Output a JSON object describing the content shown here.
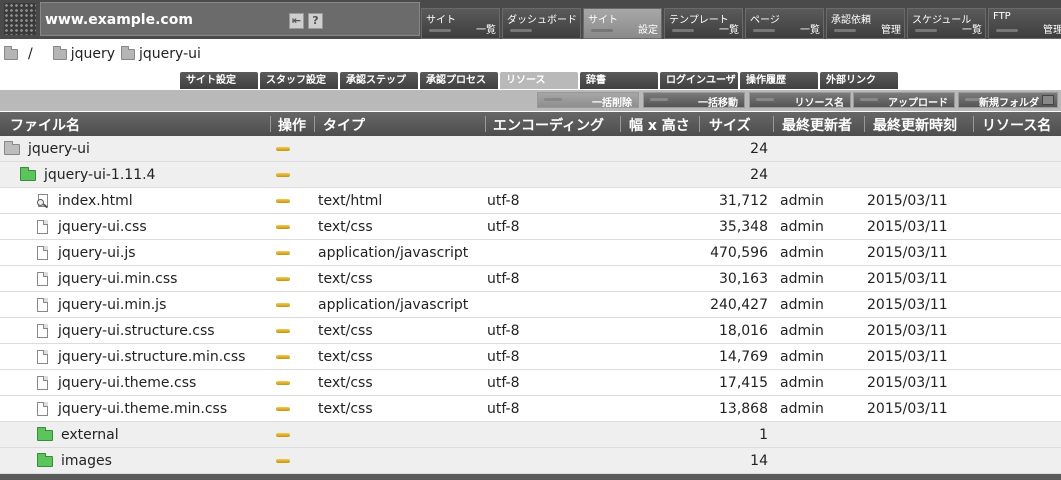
{
  "header": {
    "site_name": "www.example.com",
    "icons": [
      "logout-icon",
      "help-icon"
    ],
    "help_glyph": "?",
    "logout_glyph": "⇤",
    "nav": [
      {
        "line1": "サイト",
        "line2": "一覧",
        "active": false
      },
      {
        "line1": "ダッシュボード",
        "line2": "",
        "active": false
      },
      {
        "line1": "サイト",
        "line2": "設定",
        "active": true
      },
      {
        "line1": "テンプレート",
        "line2": "一覧",
        "active": false
      },
      {
        "line1": "ページ",
        "line2": "一覧",
        "active": false
      },
      {
        "line1": "承認依頼",
        "line2": "管理",
        "active": false
      },
      {
        "line1": "スケジュール",
        "line2": "一覧",
        "active": false
      },
      {
        "line1": "FTP",
        "line2": "管理",
        "active": false
      }
    ]
  },
  "breadcrumb": {
    "root": "/",
    "items": [
      "jquery",
      "jquery-ui"
    ]
  },
  "tabs": [
    {
      "label": "サイト設定",
      "active": false
    },
    {
      "label": "スタッフ設定",
      "active": false
    },
    {
      "label": "承認ステップ",
      "active": false
    },
    {
      "label": "承認プロセス",
      "active": false
    },
    {
      "label": "リソース",
      "active": true
    },
    {
      "label": "辞書",
      "active": false
    },
    {
      "label": "ログインユーザ",
      "active": false
    },
    {
      "label": "操作履歴",
      "active": false
    },
    {
      "label": "外部リンク",
      "active": false
    }
  ],
  "actions": {
    "bulk_delete": "一括削除",
    "bulk_move": "一括移動",
    "resource_name": "リソース名",
    "upload": "アップロード",
    "new_folder": "新規フォルダ"
  },
  "table": {
    "columns": [
      "ファイル名",
      "操作",
      "タイプ",
      "エンコーディング",
      "幅 x 高さ",
      "サイズ",
      "最終更新者",
      "最終更新時刻",
      "リソース名"
    ],
    "rows": [
      {
        "kind": "folder-grey",
        "indent": 0,
        "name": "jquery-ui",
        "type": "",
        "encoding": "",
        "size": "24",
        "user": "",
        "time": ""
      },
      {
        "kind": "folder-green",
        "indent": 1,
        "name": "jquery-ui-1.11.4",
        "type": "",
        "encoding": "",
        "size": "24",
        "user": "",
        "time": ""
      },
      {
        "kind": "html",
        "indent": 2,
        "name": "index.html",
        "type": "text/html",
        "encoding": "utf-8",
        "size": "31,712",
        "user": "admin",
        "time": "2015/03/11"
      },
      {
        "kind": "file",
        "indent": 2,
        "name": "jquery-ui.css",
        "type": "text/css",
        "encoding": "utf-8",
        "size": "35,348",
        "user": "admin",
        "time": "2015/03/11"
      },
      {
        "kind": "file",
        "indent": 2,
        "name": "jquery-ui.js",
        "type": "application/javascript",
        "encoding": "",
        "size": "470,596",
        "user": "admin",
        "time": "2015/03/11"
      },
      {
        "kind": "file",
        "indent": 2,
        "name": "jquery-ui.min.css",
        "type": "text/css",
        "encoding": "utf-8",
        "size": "30,163",
        "user": "admin",
        "time": "2015/03/11"
      },
      {
        "kind": "file",
        "indent": 2,
        "name": "jquery-ui.min.js",
        "type": "application/javascript",
        "encoding": "",
        "size": "240,427",
        "user": "admin",
        "time": "2015/03/11"
      },
      {
        "kind": "file",
        "indent": 2,
        "name": "jquery-ui.structure.css",
        "type": "text/css",
        "encoding": "utf-8",
        "size": "18,016",
        "user": "admin",
        "time": "2015/03/11"
      },
      {
        "kind": "file",
        "indent": 2,
        "name": "jquery-ui.structure.min.css",
        "type": "text/css",
        "encoding": "utf-8",
        "size": "14,769",
        "user": "admin",
        "time": "2015/03/11"
      },
      {
        "kind": "file",
        "indent": 2,
        "name": "jquery-ui.theme.css",
        "type": "text/css",
        "encoding": "utf-8",
        "size": "17,415",
        "user": "admin",
        "time": "2015/03/11"
      },
      {
        "kind": "file",
        "indent": 2,
        "name": "jquery-ui.theme.min.css",
        "type": "text/css",
        "encoding": "utf-8",
        "size": "13,868",
        "user": "admin",
        "time": "2015/03/11"
      },
      {
        "kind": "folder-green",
        "indent": 2,
        "name": "external",
        "type": "",
        "encoding": "",
        "size": "1",
        "user": "",
        "time": ""
      },
      {
        "kind": "folder-green",
        "indent": 2,
        "name": "images",
        "type": "",
        "encoding": "",
        "size": "14",
        "user": "",
        "time": ""
      }
    ]
  }
}
